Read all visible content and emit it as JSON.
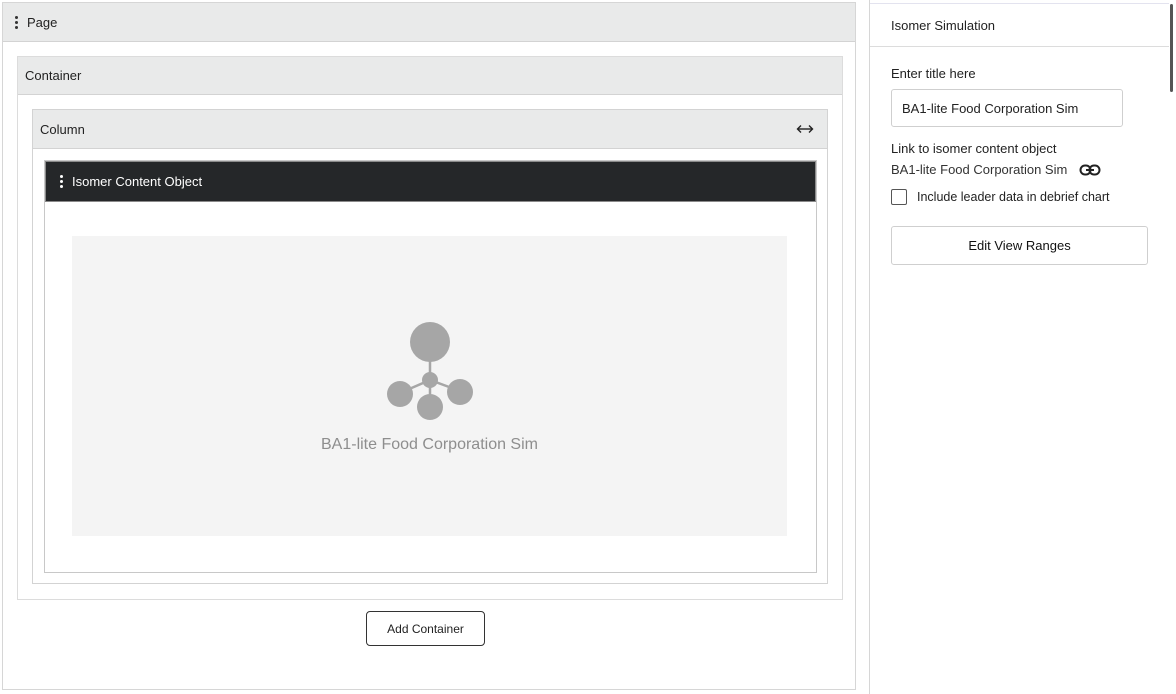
{
  "editor": {
    "page_label": "Page",
    "container_label": "Container",
    "column_label": "Column",
    "object_label": "Isomer Content Object",
    "preview_title": "BA1-lite Food Corporation Sim",
    "add_container_label": "Add Container"
  },
  "panel": {
    "header": "Isomer Simulation",
    "title_label": "Enter title here",
    "title_value": "BA1-lite Food Corporation Sim",
    "link_label": "Link to isomer content object",
    "link_value": "BA1-lite Food Corporation Sim",
    "checkbox_label": "Include leader data in debrief chart",
    "checkbox_checked": false,
    "edit_ranges_label": "Edit View Ranges"
  },
  "icons": {
    "page_menu": "kebab-menu-icon",
    "object_menu": "kebab-menu-icon",
    "column_resize": "horizontal-resize-icon",
    "preview": "isomer-simulation-icon",
    "link": "link-icon"
  },
  "colors": {
    "header_bg": "#e9eaea",
    "object_header_bg": "#252729",
    "preview_bg": "#f4f4f4",
    "logo_grey": "#a6a6a6"
  }
}
